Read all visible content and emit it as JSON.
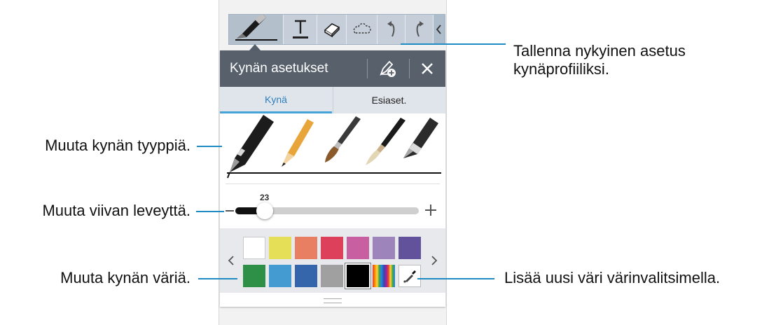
{
  "toolbar": {
    "tools": [
      "pen-icon",
      "text-icon",
      "eraser-icon",
      "selection-icon",
      "undo-icon",
      "redo-icon",
      "chevron-left-icon"
    ]
  },
  "panel": {
    "title": "Kynän asetukset",
    "tabs": [
      {
        "label": "Kynä",
        "active": true
      },
      {
        "label": "Esiaset.",
        "active": false
      }
    ],
    "pen_types": [
      "pen",
      "pencil",
      "brush",
      "calligraphy-pen",
      "marker"
    ],
    "thickness": 23,
    "colors": {
      "row1": [
        "#ffffff",
        "#e5df58",
        "#e87f62",
        "#dd405a",
        "#c75fa0",
        "#9d85bb",
        "#62529b"
      ],
      "row2": [
        "#2e8f47",
        "#439bd2",
        "#3566ac",
        "#a0a0a0",
        "#000000",
        "rainbow",
        "eyedropper"
      ]
    },
    "selected_color": "#000000"
  },
  "callouts": {
    "save_profile": "Tallenna nykyinen asetus\nkynäprofiiliksi.",
    "pen_type": "Muuta kynän tyyppiä.",
    "line_width": "Muuta viivan leveyttä.",
    "pen_color": "Muuta kynän väriä.",
    "add_color": "Lisää uusi väri värinvalitsimella."
  },
  "accent_color": "#1e8bc3"
}
